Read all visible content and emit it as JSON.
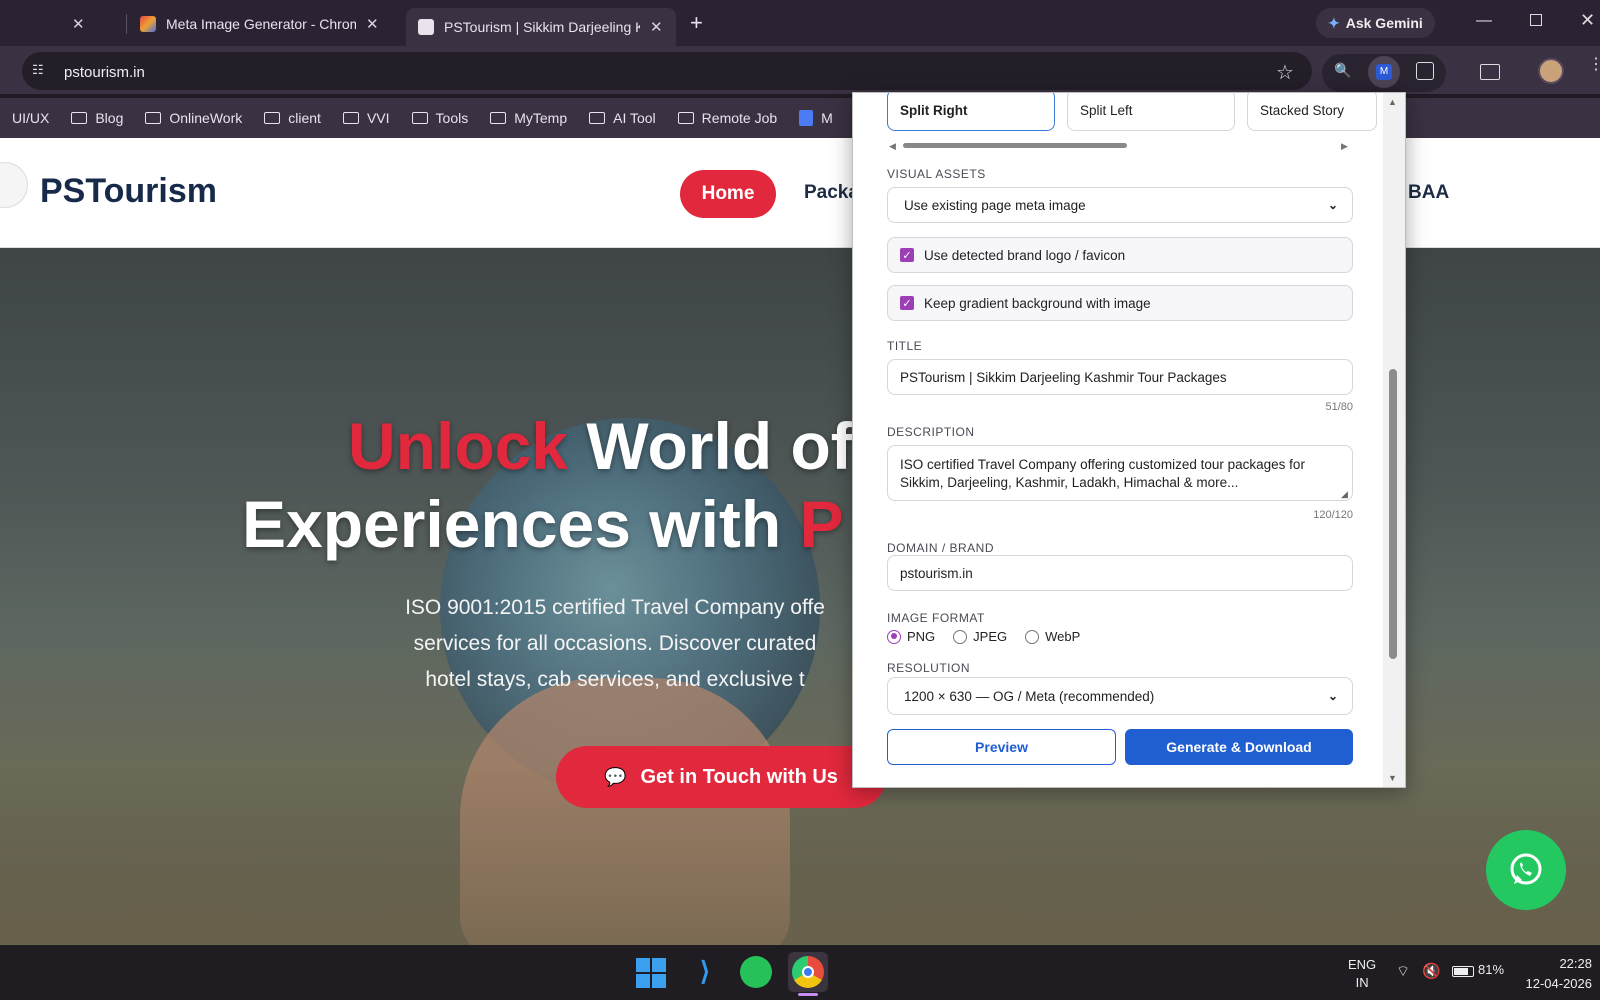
{
  "tabs": [
    {
      "title": ""
    },
    {
      "title": "Meta Image Generator - Chrom"
    },
    {
      "title": "PSTourism | Sikkim Darjeeling K"
    }
  ],
  "gemini": {
    "label": "Ask Gemini"
  },
  "address": {
    "url": "pstourism.in"
  },
  "bookmarks": [
    "UI/UX",
    "Blog",
    "OnlineWork",
    "client",
    "VVI",
    "Tools",
    "MyTemp",
    "AI Tool",
    "Remote Job",
    "M"
  ],
  "site": {
    "logo": "PSTourism",
    "nav": {
      "home": "Home",
      "packages": "Packa",
      "right": "BAA"
    },
    "hero": {
      "line1_red": "Unlock",
      "line1_white": "World of",
      "line2_white": "Experiences with",
      "line2_red": "P",
      "para": [
        "ISO 9001:2015 certified Travel Company offe",
        "services for all occasions. Discover curated",
        "hotel stays, cab services, and exclusive t"
      ],
      "cta": "Get in Touch with Us"
    }
  },
  "popup": {
    "layouts": [
      "Split Right",
      "Split Left",
      "Stacked Story"
    ],
    "visual_assets": {
      "label": "VISUAL ASSETS",
      "value": "Use existing page meta image"
    },
    "checks": [
      "Use detected brand logo / favicon",
      "Keep gradient background with image"
    ],
    "title": {
      "label": "TITLE",
      "value": "PSTourism | Sikkim Darjeeling Kashmir Tour Packages",
      "count": "51/80"
    },
    "description": {
      "label": "DESCRIPTION",
      "line1": "ISO certified Travel Company offering customized tour packages for",
      "line2": "Sikkim, Darjeeling, Kashmir, Ladakh, Himachal & more...",
      "count": "120/120"
    },
    "domain": {
      "label": "DOMAIN / BRAND",
      "value": "pstourism.in"
    },
    "format": {
      "label": "IMAGE FORMAT",
      "options": [
        "PNG",
        "JPEG",
        "WebP"
      ],
      "selected": "PNG"
    },
    "resolution": {
      "label": "RESOLUTION",
      "value": "1200 × 630 — OG / Meta (recommended)"
    },
    "buttons": {
      "preview": "Preview",
      "generate": "Generate & Download"
    }
  },
  "taskbar": {
    "lang1": "ENG",
    "lang2": "IN",
    "battery": "81%",
    "time": "22:28",
    "date": "12-04-2026"
  }
}
